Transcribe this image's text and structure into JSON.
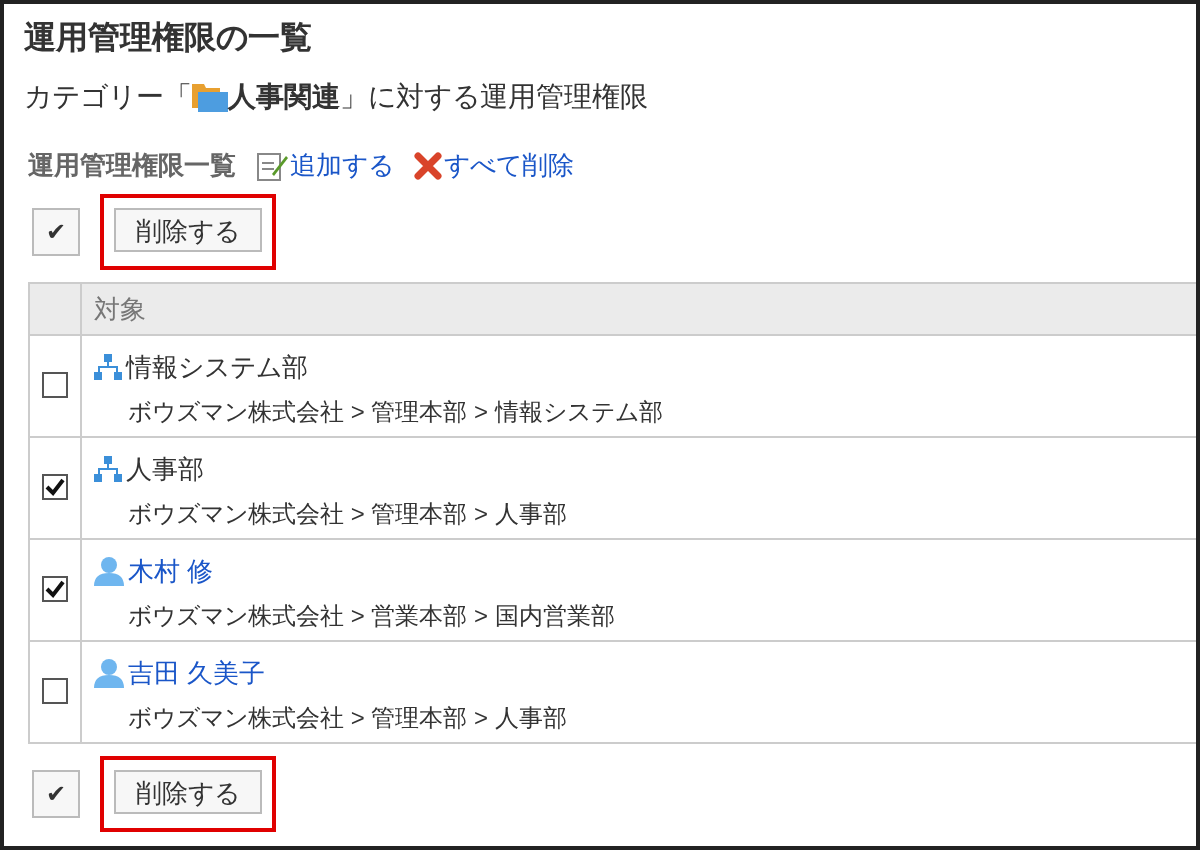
{
  "title": "運用管理権限の一覧",
  "subtitle": {
    "before": "カテゴリー「",
    "category": "人事関連",
    "after": "」に対する運用管理権限"
  },
  "section": {
    "label": "運用管理権限一覧",
    "actions": [
      {
        "kind": "add",
        "label": "追加する"
      },
      {
        "kind": "delete_all",
        "label": "すべて削除"
      }
    ]
  },
  "toggle_all": "✔",
  "delete_button": "削除する",
  "table": {
    "columns": [
      "対象"
    ],
    "rows": [
      {
        "kind": "group",
        "name": "情報システム部",
        "path": "ボウズマン株式会社 > 管理本部 > 情報システム部",
        "checked": false
      },
      {
        "kind": "group",
        "name": "人事部",
        "path": "ボウズマン株式会社 > 管理本部 > 人事部",
        "checked": true
      },
      {
        "kind": "user",
        "name": "木村 修",
        "path": "ボウズマン株式会社 > 営業本部 > 国内営業部",
        "checked": true
      },
      {
        "kind": "user",
        "name": "吉田 久美子",
        "path": "ボウズマン株式会社 > 管理本部 > 人事部",
        "checked": false
      }
    ]
  },
  "bottom_toggle_all": "✔",
  "bottom_delete_button": "削除する"
}
